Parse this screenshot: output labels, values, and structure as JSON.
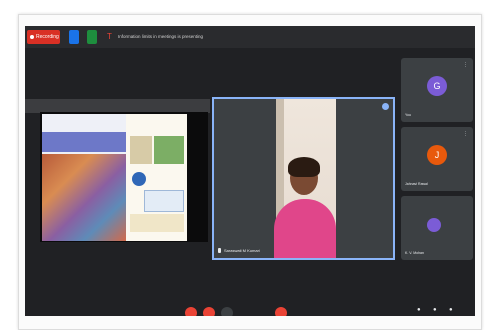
{
  "topbar": {
    "recording_label": "Recording",
    "notice_text": "Information limits in meetings is presenting"
  },
  "presentation": {
    "slide_left_title": "",
    "slide_right_title": ""
  },
  "camera": {
    "name": "Saraswati M Kumari"
  },
  "participants": [
    {
      "initial": "G",
      "name": "You",
      "color": "#7b5cd6"
    },
    {
      "initial": "J",
      "name": "Jahnavi Rawal",
      "color": "#e8590c"
    },
    {
      "initial": "",
      "name": "K. V. Mohan",
      "color": "#7b5cd6"
    }
  ],
  "icons": {
    "recording": "record-dot-icon",
    "shield": "shield-icon",
    "lock": "lock-icon",
    "notice": "caption-icon",
    "pin": "pin-icon",
    "mic": "mic-icon",
    "more": "more-vert-icon"
  },
  "colors": {
    "background": "#202124",
    "tile": "#3c4043",
    "recording": "#d93025",
    "active_border": "#8ab4f8"
  }
}
